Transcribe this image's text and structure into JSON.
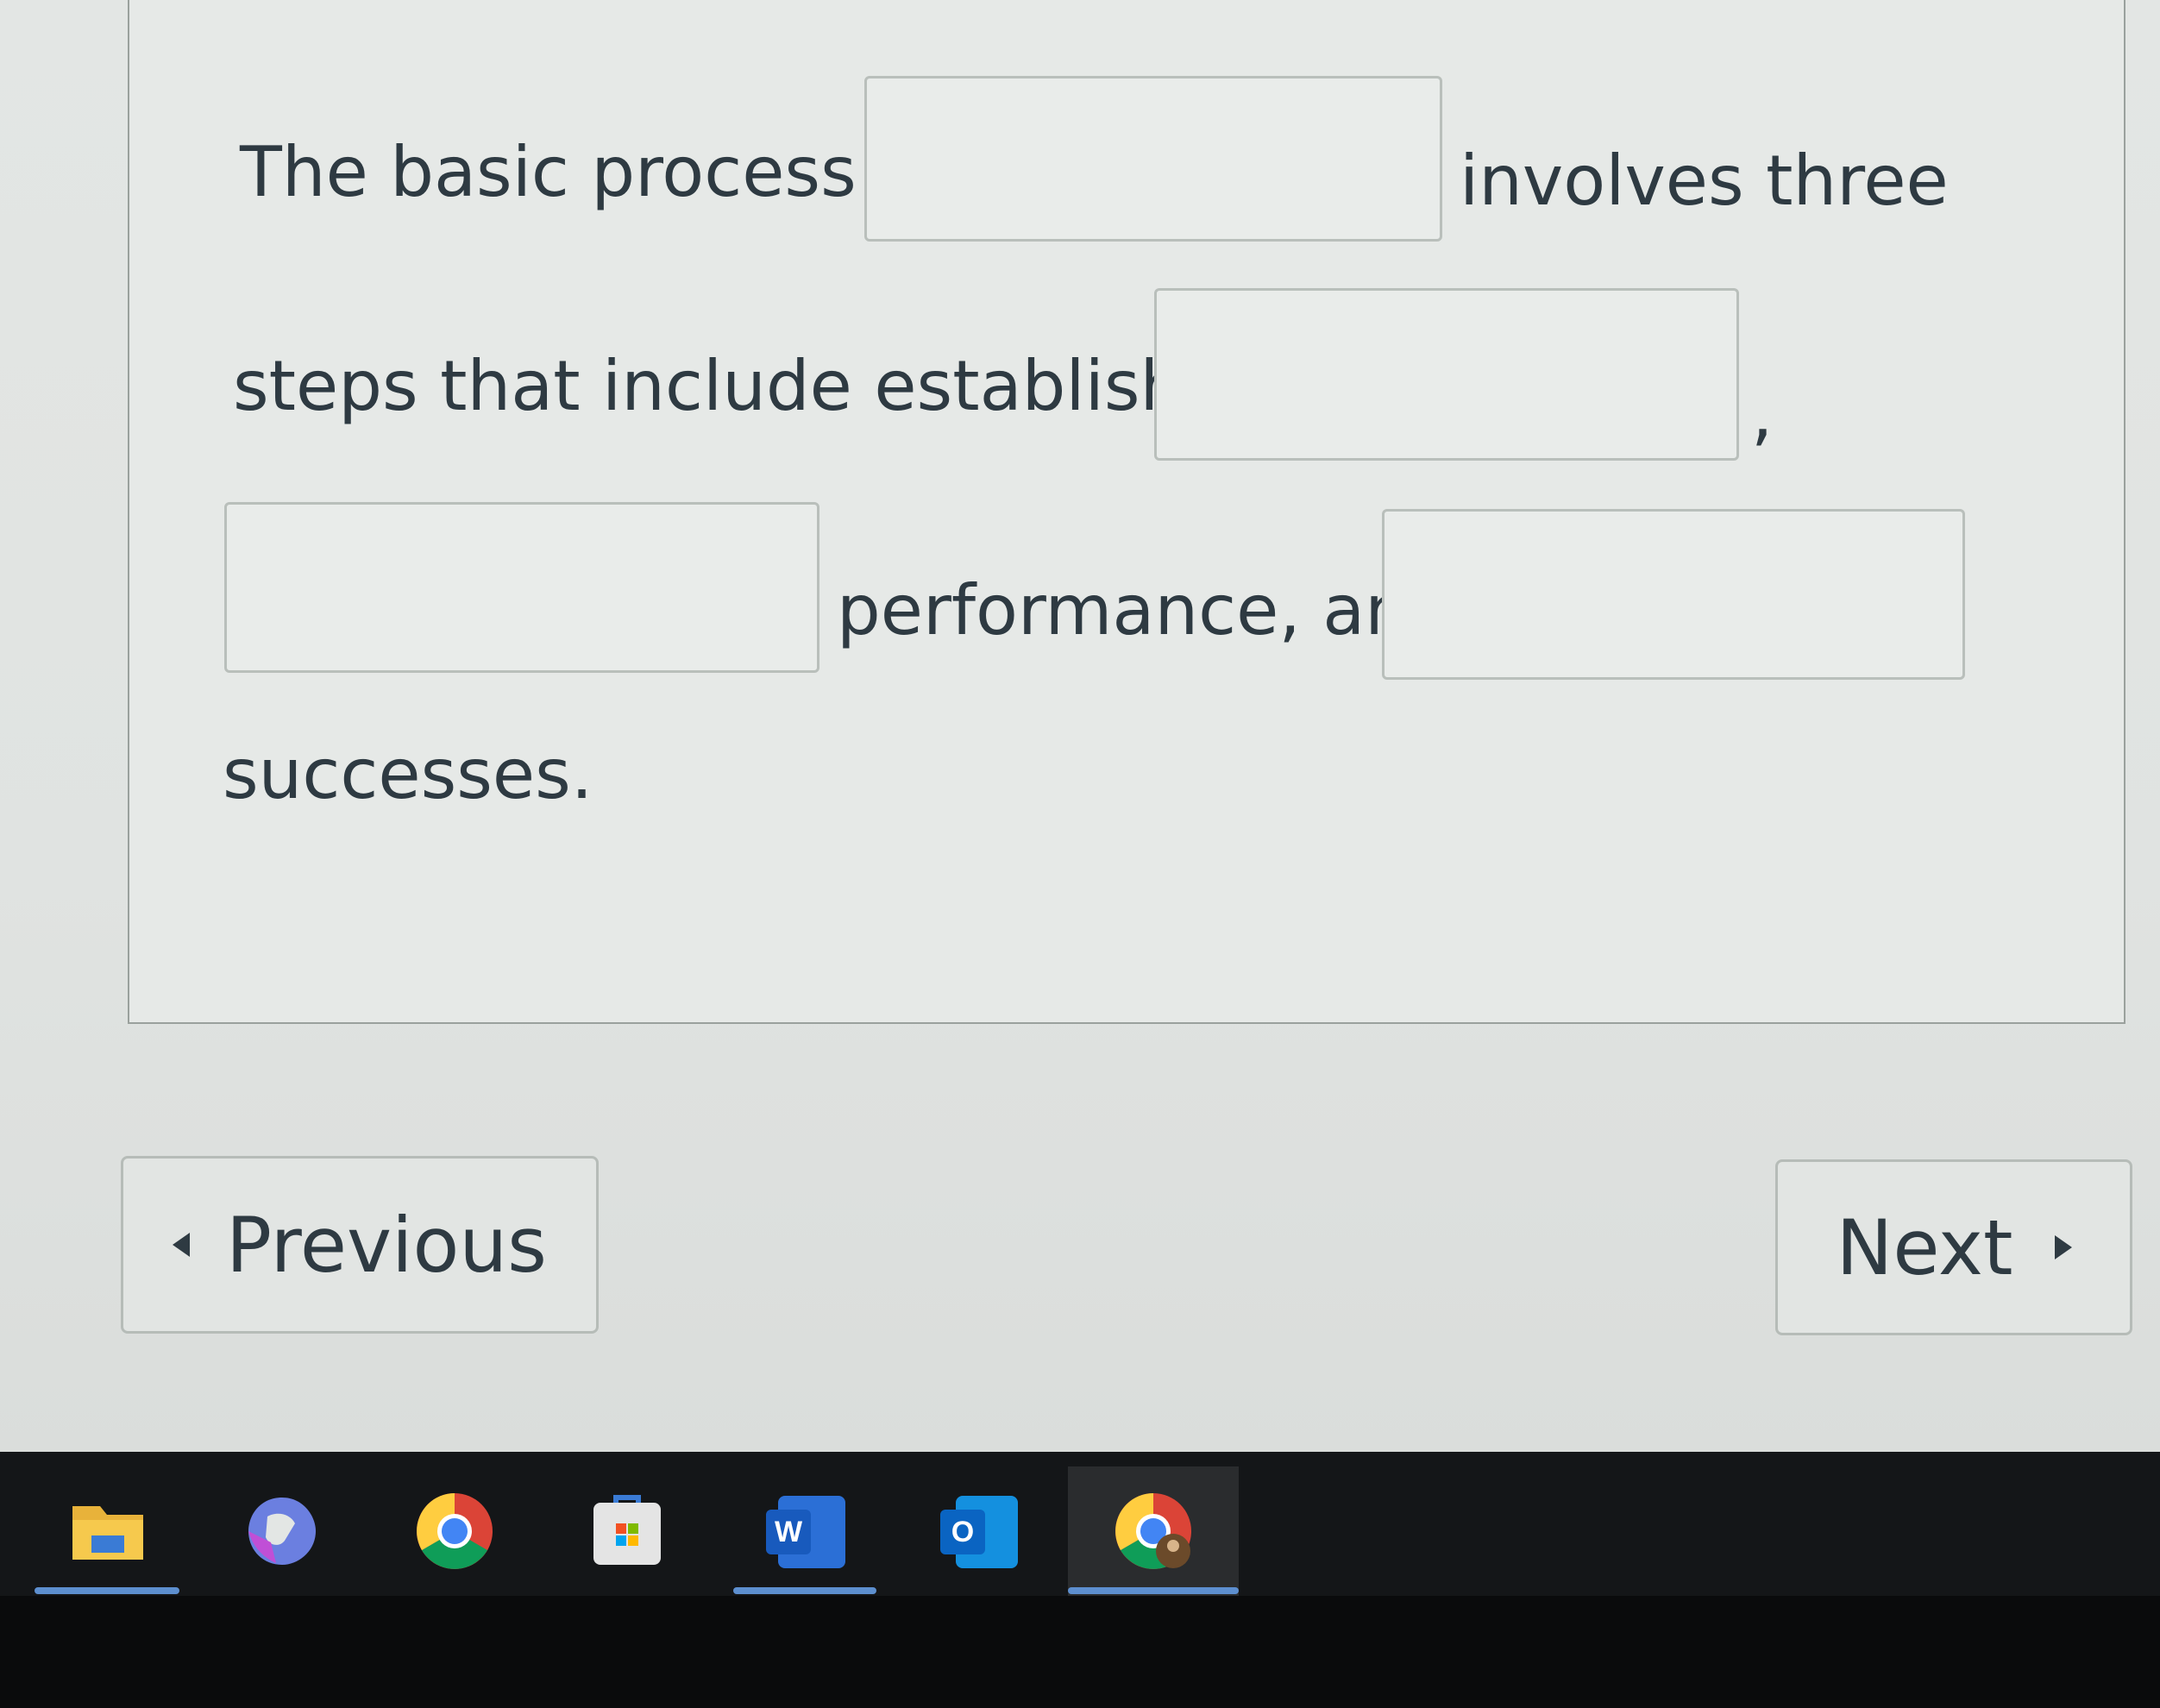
{
  "question": {
    "line1_text": "The basic process of",
    "line1_after": "involves three",
    "line2_text": "steps that include establishing",
    "comma": ",",
    "line3_after": "performance, and",
    "line4_text": "successes.",
    "blanks": [
      "",
      "",
      "",
      ""
    ]
  },
  "navigation": {
    "previous_label": "Previous",
    "next_label": "Next"
  },
  "taskbar": {
    "word_icon_letter": "W",
    "outlook_icon_letter": "O",
    "items": [
      "file-explorer-icon",
      "copilot-icon",
      "chrome-icon",
      "microsoft-store-icon",
      "word-icon",
      "outlook-icon",
      "chrome-profile-icon"
    ],
    "accent_color": "#5d8fcf"
  }
}
